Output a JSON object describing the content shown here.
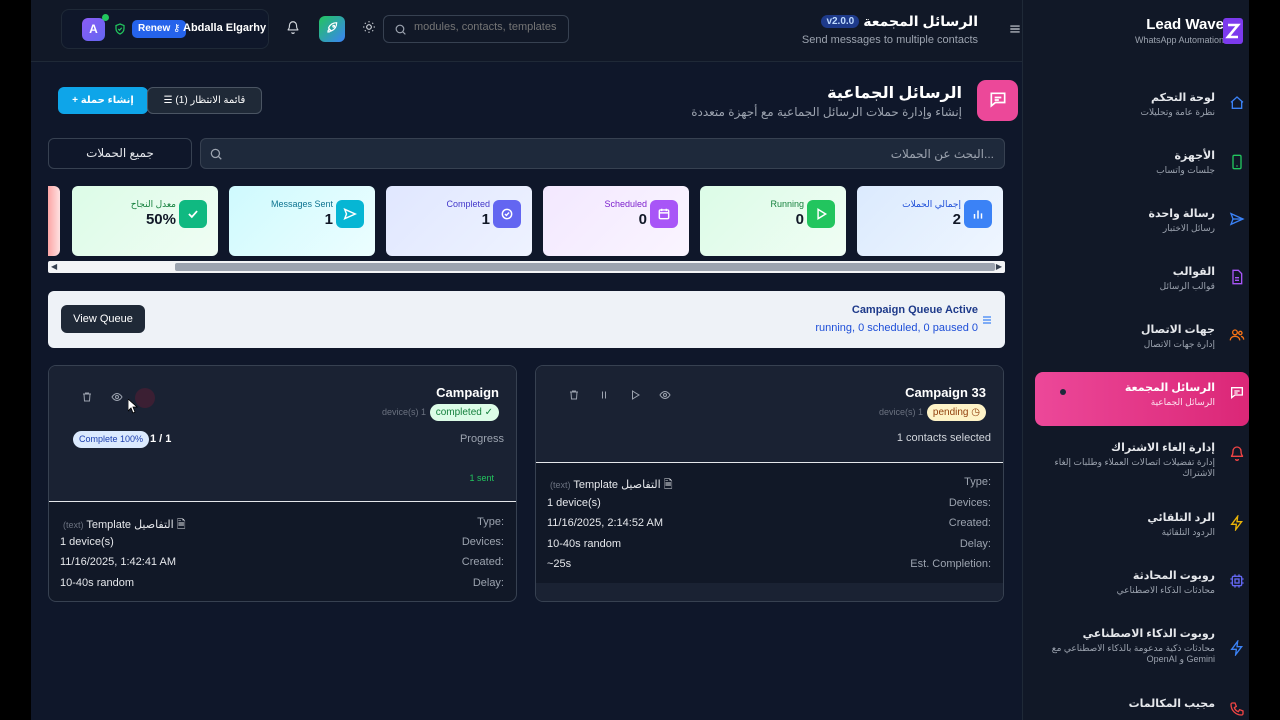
{
  "header": {
    "avatar_letter": "A",
    "renew_label": "Renew",
    "user_name": "Abdalla Elgarhy",
    "search_placeholder": "modules, contacts, templates",
    "title": "الرسائل المجمعة",
    "version": "v2.0.0",
    "subtitle": "Send messages to multiple contacts"
  },
  "sidebar": {
    "brand_name": "Lead Wave",
    "brand_sub": "WhatsApp Automation",
    "items": [
      {
        "label": "لوحة التحكم",
        "sub": "نظرة عامة وتحليلات",
        "icon": "home-icon"
      },
      {
        "label": "الأجهزة",
        "sub": "جلسات واتساب",
        "icon": "phone-icon"
      },
      {
        "label": "رسالة واحدة",
        "sub": "رسائل الاختبار",
        "icon": "send-icon"
      },
      {
        "label": "القوالب",
        "sub": "قوالب الرسائل",
        "icon": "document-icon"
      },
      {
        "label": "جهات الاتصال",
        "sub": "إدارة جهات الاتصال",
        "icon": "users-icon"
      },
      {
        "label": "الرسائل المجمعة",
        "sub": "الرسائل الجماعية",
        "icon": "chat-icon"
      },
      {
        "label": "إدارة إلغاء الاشتراك",
        "sub": "إدارة تفضيلات اتصالات العملاء وطلبات إلغاء الاشتراك",
        "icon": "bell-off-icon"
      },
      {
        "label": "الرد التلقائي",
        "sub": "الردود التلقائية",
        "icon": "lightning-icon"
      },
      {
        "label": "روبوت المحادثة",
        "sub": "محادثات الذكاء الاصطناعي",
        "icon": "cpu-icon"
      },
      {
        "label": "روبوت الذكاء الاصطناعي",
        "sub": "محادثات ذكية مدعومة بالذكاء الاصطناعي مع OpenAI و Gemini",
        "icon": "bolt-icon"
      },
      {
        "label": "مجيب المكالمات",
        "sub": "",
        "icon": "phone-call-icon"
      }
    ]
  },
  "page": {
    "title": "الرسائل الجماعية",
    "subtitle": "إنشاء وإدارة حملات الرسائل الجماعية مع أجهزة متعددة",
    "create_label": "إنشاء حملة",
    "queue_label": "قائمة الانتظار (1)",
    "filter_label": "جميع الحملات",
    "search_placeholder": "البحث عن الحملات..."
  },
  "stats": [
    {
      "label": "إجمالي الحملات",
      "value": "2",
      "color": "#3b82f6"
    },
    {
      "label": "Running",
      "value": "0",
      "color": "#22c55e"
    },
    {
      "label": "Scheduled",
      "value": "0",
      "color": "#a855f7"
    },
    {
      "label": "Completed",
      "value": "1",
      "color": "#6366f1"
    },
    {
      "label": "Messages Sent",
      "value": "1",
      "color": "#06b6d4"
    },
    {
      "label": "معدل النجاح",
      "value": "50%",
      "color": "#10b981"
    }
  ],
  "queue_banner": {
    "title": "Campaign Queue Active",
    "status": "running, 0 scheduled, 0 paused 0",
    "view_label": "View Queue"
  },
  "campaigns": [
    {
      "name": "Campaign",
      "status": "completed",
      "devices_mini": "device(s) 1",
      "progress_label": "Progress",
      "progress_badge": "Complete 100%",
      "progress_count": "1 / 1",
      "sent_label": "1 sent",
      "type_label": "Type:",
      "type_value": "Template التفاصيل",
      "type_note": "(text)",
      "devices_label": "Devices:",
      "devices_value": "1 device(s)",
      "created_label": "Created:",
      "created_value": "11/16/2025, 1:42:41 AM",
      "delay_label": "Delay:",
      "delay_value": "10-40s random"
    },
    {
      "name": "Campaign 33",
      "status": "pending",
      "devices_mini": "device(s) 1",
      "contacts_selected": "1 contacts selected",
      "type_label": "Type:",
      "type_value": "Template التفاصيل",
      "type_note": "(text)",
      "devices_label": "Devices:",
      "devices_value": "1 device(s)",
      "created_label": "Created:",
      "created_value": "11/16/2025, 2:14:52 AM",
      "delay_label": "Delay:",
      "delay_value": "10-40s random",
      "est_label": "Est. Completion:",
      "est_value": "~25s"
    }
  ]
}
